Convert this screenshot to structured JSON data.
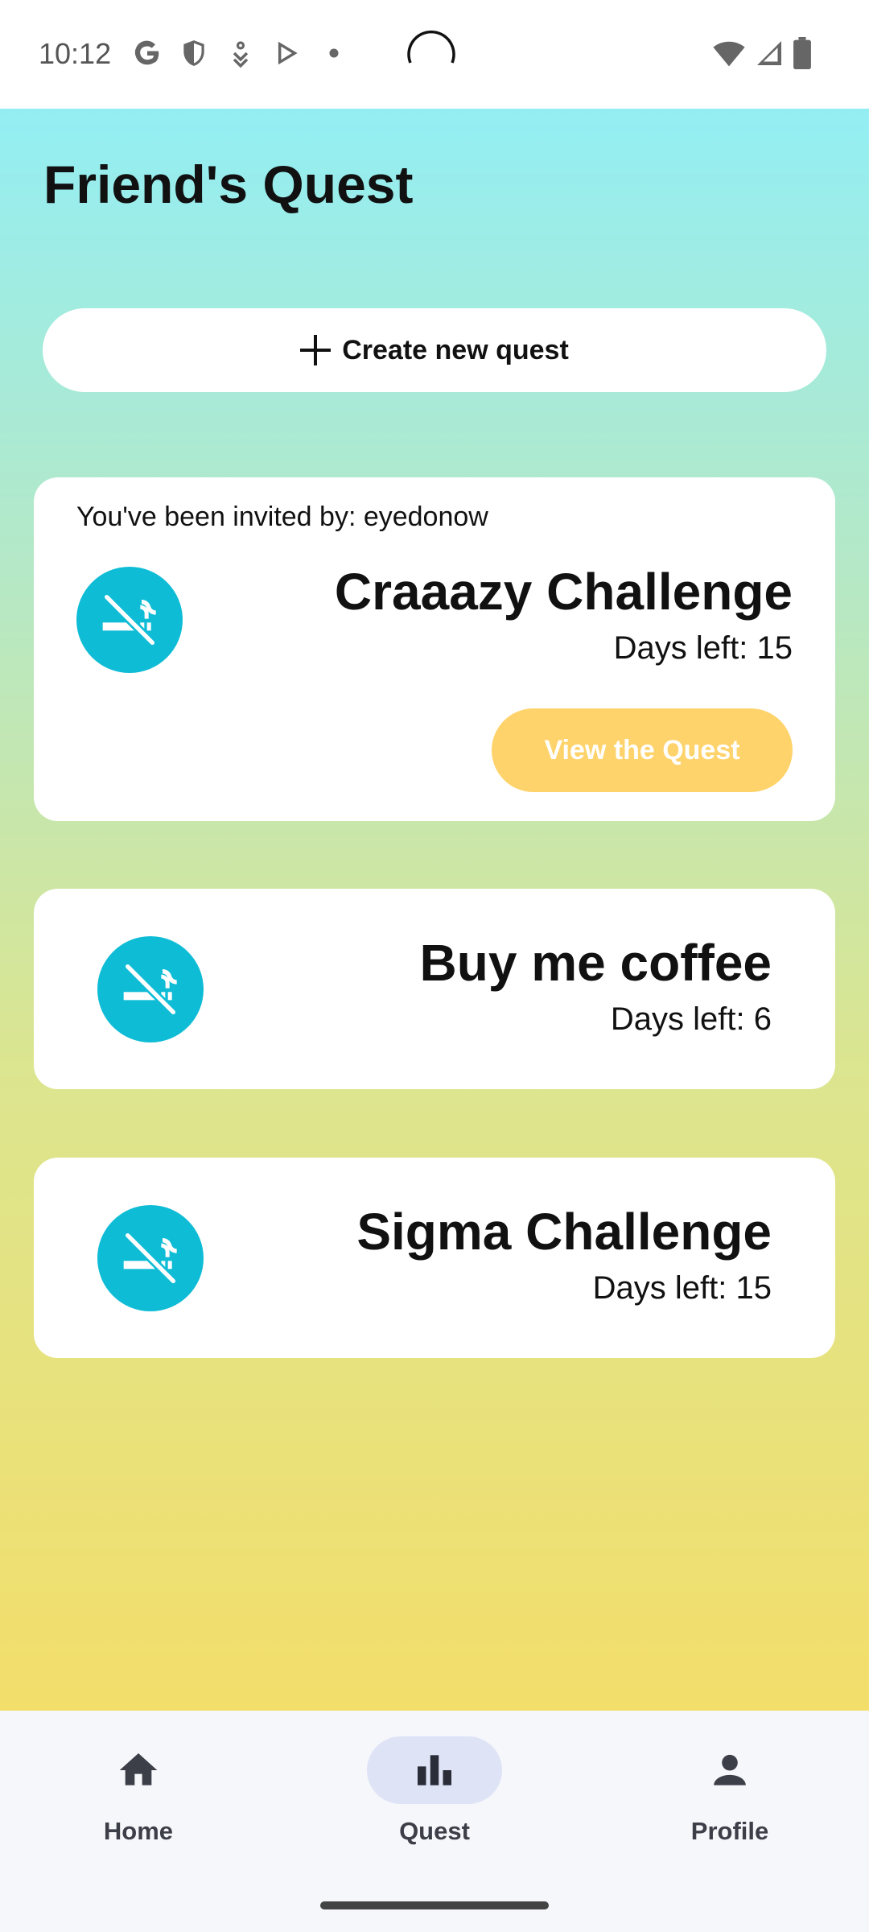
{
  "status_bar": {
    "time": "10:12",
    "icons": [
      "google-icon",
      "shield-icon",
      "download-icon",
      "play-store-icon",
      "dot-icon",
      "loading-spinner",
      "wifi-icon",
      "signal-icon",
      "battery-icon"
    ]
  },
  "header": {
    "title": "Friend's Quest"
  },
  "actions": {
    "create_label": "Create new quest"
  },
  "quests": [
    {
      "invited_by": "You've been invited by: eyedonow",
      "title": "Craaazy Challenge",
      "days_left": "Days left: 15",
      "button": "View the Quest",
      "icon": "no-smoking-icon"
    },
    {
      "title": "Buy me coffee",
      "days_left": "Days left: 6",
      "icon": "no-smoking-icon"
    },
    {
      "title": "Sigma Challenge",
      "days_left": "Days left: 15",
      "icon": "no-smoking-icon"
    }
  ],
  "bottom_nav": {
    "items": [
      {
        "label": "Home",
        "icon": "home-icon"
      },
      {
        "label": "Quest",
        "icon": "bar-chart-icon",
        "selected": true
      },
      {
        "label": "Profile",
        "icon": "person-icon"
      }
    ]
  },
  "colors": {
    "accent": "#0fbcd6",
    "view_button": "#ffd36b",
    "nav_selected_pill": "#dfe3f6",
    "gradient_top": "#93eef3",
    "gradient_bottom": "#f3de6a"
  }
}
